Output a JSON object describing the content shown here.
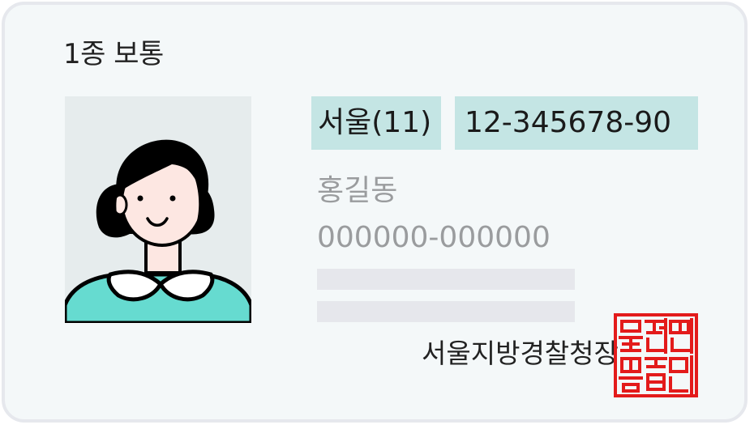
{
  "license": {
    "type": "1종 보통",
    "region": "서울(11)",
    "number": "12-345678-90",
    "name": "홍길동",
    "resident_id": "000000-000000",
    "issuer": "서울지방경찰청장",
    "seal_text": "운전면허증인"
  },
  "photo": {
    "icon": "person-portrait-icon",
    "skin_color": "#fde7e2",
    "hair_color": "#000000",
    "shirt_color": "#66dbd0"
  },
  "colors": {
    "card_bg": "#f4f8f9",
    "card_border": "#e6e8ed",
    "pill_bg": "#c4e5e4",
    "muted_text": "#9a9c9e",
    "placeholder_bar": "#e6e7ec",
    "seal_red": "#e31b1b"
  }
}
